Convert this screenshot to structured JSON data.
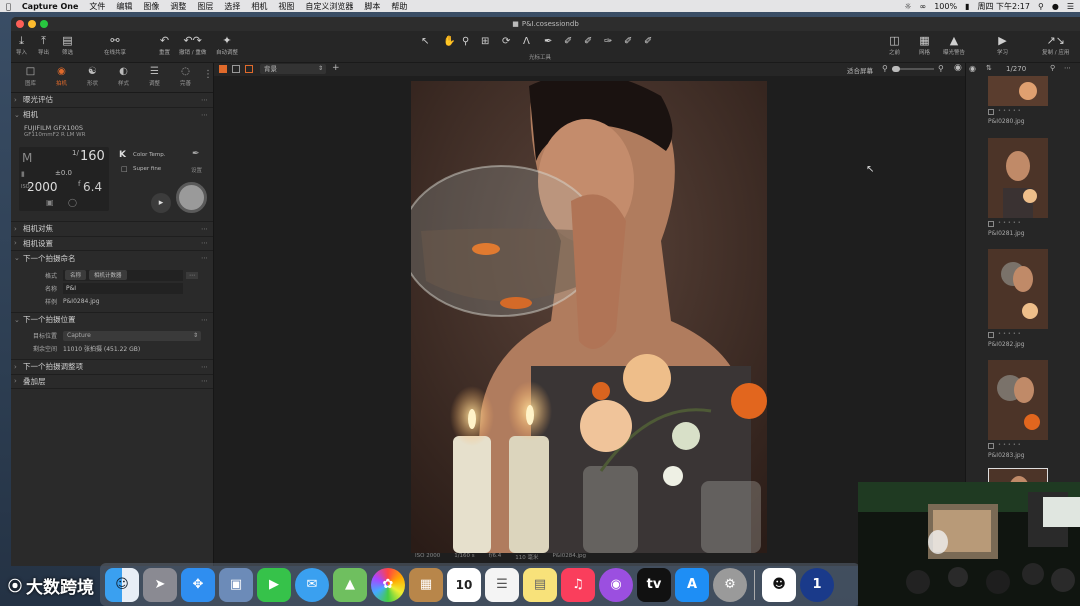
{
  "menubar": {
    "app": "Capture One",
    "items": [
      "文件",
      "编辑",
      "图像",
      "调整",
      "图层",
      "选择",
      "相机",
      "视图",
      "自定义浏览器",
      "脚本",
      "帮助"
    ],
    "battery": "100%",
    "clock": "周四 下午2:17"
  },
  "window": {
    "title": "P&I.cosessiondb"
  },
  "toolbar": {
    "left": [
      {
        "icon": "import-icon",
        "label": "导入"
      },
      {
        "icon": "export-icon",
        "label": "导出"
      },
      {
        "icon": "filter-icon",
        "label": "筛选"
      },
      {
        "icon": "share-icon",
        "label": "在线共享"
      },
      {
        "icon": "reset-icon",
        "label": "重置"
      },
      {
        "icon": "undo-icon",
        "label": "撤销 / 重做"
      },
      {
        "icon": "auto-adjust-icon",
        "label": "自动调整"
      }
    ],
    "cursor_label": "光标工具",
    "right": [
      {
        "icon": "before-icon",
        "label": "之前"
      },
      {
        "icon": "grid-icon",
        "label": "网格"
      },
      {
        "icon": "exposure-warning-icon",
        "label": "曝光警告"
      },
      {
        "icon": "learn-icon",
        "label": "学习"
      },
      {
        "icon": "copy-apply-icon",
        "label": "复制 / 应用"
      }
    ]
  },
  "tooltabs": [
    {
      "icon": "library-icon",
      "label": "图库"
    },
    {
      "icon": "camera-icon",
      "label": "拍机"
    },
    {
      "icon": "shape-icon",
      "label": "形状"
    },
    {
      "icon": "style-icon",
      "label": "样式"
    },
    {
      "icon": "adjust-icon",
      "label": "调整"
    },
    {
      "icon": "finish-icon",
      "label": "完善"
    }
  ],
  "left": {
    "exposure_eval": "曝光评估",
    "camera": "相机",
    "camera_model": "FUJIFILM GFX100S",
    "lens": "GF110mmF2 R LM WR",
    "mode": "M",
    "shutter_num": "1/",
    "shutter": "160",
    "ev": "±0.0",
    "iso": "2000",
    "aperture_f": "f",
    "aperture": "6.4",
    "wb_k": "K",
    "wb_label": "Color Temp.",
    "quality": "Super fine",
    "settings_label": "设置",
    "camera_focus": "相机对焦",
    "camera_settings": "相机设置",
    "next_name": "下一个拍摄命名",
    "format_label": "格式",
    "format_tokens": [
      "名称",
      "相机计数器"
    ],
    "name_label": "名称",
    "name_value": "P&I",
    "sample_label": "样例",
    "sample_value": "P&I0284.jpg",
    "next_location": "下一个拍摄位置",
    "dest_label": "目标位置",
    "dest_value": "Capture",
    "space_label": "剩余空间",
    "space_value": "11010 张拍摄 (451.22 GB)",
    "next_adjust": "下一个拍摄调整项",
    "overlay": "叠加层"
  },
  "viewerbar": {
    "layer": "背景",
    "fit": "适合屏幕",
    "count": "1/270"
  },
  "photoinfo": {
    "iso": "ISO 2000",
    "shutter": "1/160 s",
    "aperture": "f/6.4",
    "focal": "110 毫米",
    "file": "P&I0284.jpg"
  },
  "thumbs": [
    {
      "name": "P&I0280.jpg"
    },
    {
      "name": "P&I0281.jpg"
    },
    {
      "name": "P&I0282.jpg"
    },
    {
      "name": "P&I0283.jpg"
    }
  ],
  "dock": {
    "apps": [
      "Finder",
      "Launchpad",
      "Safari",
      "Preview",
      "FaceTime",
      "Messages",
      "Maps",
      "Photos",
      "Notes",
      "Calendar",
      "Reminders",
      "Notes2",
      "Music",
      "Podcasts",
      "TV",
      "App Store",
      "System Preferences",
      "QQ",
      "1Password",
      "Other"
    ],
    "calendar_day": "10"
  },
  "watermark": "大数跨境"
}
